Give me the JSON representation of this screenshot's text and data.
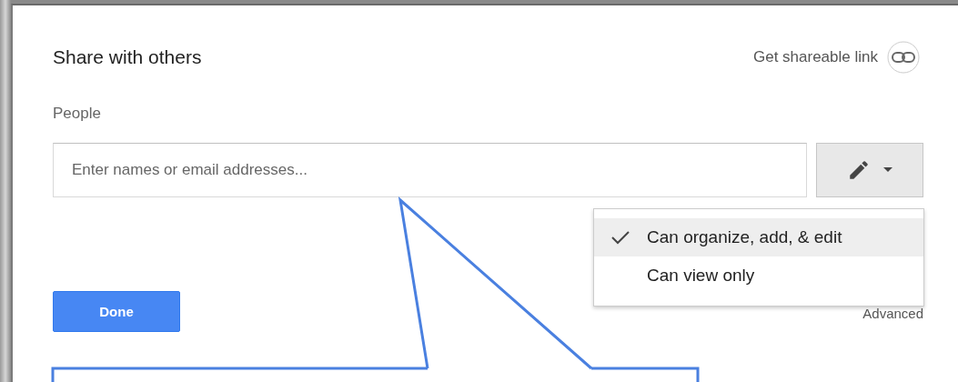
{
  "dialog": {
    "title": "Share with others",
    "link": {
      "label": "Get shareable link"
    }
  },
  "people": {
    "label": "People",
    "placeholder": "Enter names or email addresses..."
  },
  "permission_menu": {
    "expanded": true,
    "items": [
      {
        "label": "Can organize, add, & edit",
        "selected": true
      },
      {
        "label": "Can view only",
        "selected": false
      }
    ]
  },
  "buttons": {
    "done": "Done",
    "advanced": "Advanced"
  },
  "callout": {
    "kind": "callout"
  }
}
